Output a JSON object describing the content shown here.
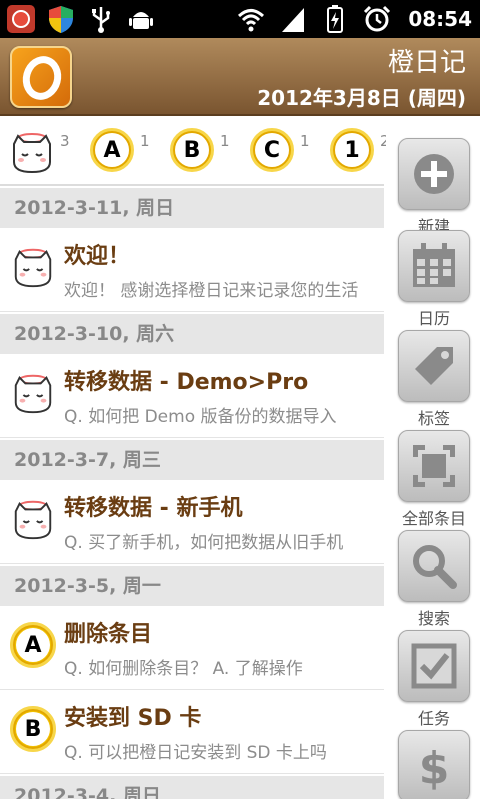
{
  "status_bar": {
    "time": "08:54",
    "icons": [
      "app-red-icon",
      "shield-icon",
      "usb-icon",
      "android-debug-icon",
      "wifi-icon",
      "signal-icon",
      "battery-charging-icon",
      "alarm-icon"
    ]
  },
  "header": {
    "app_title": "橙日记",
    "date": "2012年3月8日 (周四)"
  },
  "filters": [
    {
      "icon": "mascot-icon",
      "count": "3"
    },
    {
      "icon": "badge-a-icon",
      "letter": "A",
      "count": "1"
    },
    {
      "icon": "badge-b-icon",
      "letter": "B",
      "count": "1"
    },
    {
      "icon": "badge-c-icon",
      "letter": "C",
      "count": "1"
    },
    {
      "icon": "badge-1-icon",
      "letter": "1",
      "count": "2"
    }
  ],
  "list": {
    "sections": [
      {
        "date": "2012-3-11, 周日",
        "items": [
          {
            "icon": "mascot",
            "title": "欢迎！",
            "snippet": "欢迎！  感谢选择橙日记来记录您的生活"
          }
        ]
      },
      {
        "date": "2012-3-10, 周六",
        "items": [
          {
            "icon": "mascot",
            "title": "转移数据 - Demo>Pro",
            "snippet": "Q.  如何把 Demo 版备份的数据导入"
          }
        ]
      },
      {
        "date": "2012-3-7, 周三",
        "items": [
          {
            "icon": "mascot",
            "title": "转移数据 - 新手机",
            "snippet": "Q.  买了新手机，如何把数据从旧手机"
          }
        ]
      },
      {
        "date": "2012-3-5, 周一",
        "items": [
          {
            "icon": "A",
            "title": "删除条目",
            "snippet": "Q.  如何删除条目？  A.  了解操作"
          },
          {
            "icon": "B",
            "title": "安装到 SD 卡",
            "snippet": "Q.  可以把橙日记安装到 SD 卡上吗"
          }
        ]
      },
      {
        "date": "2012-3-4, 周日",
        "items": []
      }
    ]
  },
  "toolbar": {
    "new": "新建",
    "calendar": "日历",
    "tags": "标签",
    "all": "全部条目",
    "search": "搜索",
    "tasks": "任务",
    "money": ""
  },
  "colors": {
    "header_top": "#b08a5c",
    "header_bottom": "#7a5530",
    "title_brown": "#6a3d12",
    "badge_yellow": "#f2c200"
  }
}
